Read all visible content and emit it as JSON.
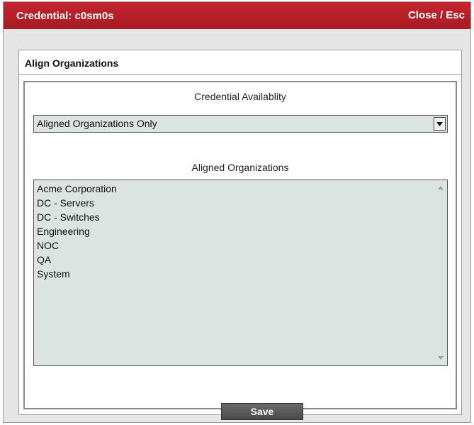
{
  "window": {
    "title": "Credential: c0sm0s",
    "close_label": "Close / Esc"
  },
  "panel": {
    "heading": "Align Organizations"
  },
  "availability": {
    "label": "Credential Availablity",
    "selected": "Aligned Organizations Only"
  },
  "organizations": {
    "label": "Aligned Organizations",
    "items": [
      "Acme Corporation",
      "DC - Servers",
      "DC - Switches",
      "Engineering",
      "NOC",
      "QA",
      "System"
    ]
  },
  "actions": {
    "save_label": "Save"
  },
  "icons": {
    "dropdown": "chevron-down-icon",
    "scroll_up": "scroll-up-icon",
    "scroll_down": "scroll-down-icon"
  },
  "colors": {
    "titlebar": "#b3202a",
    "field_background": "#dbe4e0",
    "save_button": "#555555"
  }
}
